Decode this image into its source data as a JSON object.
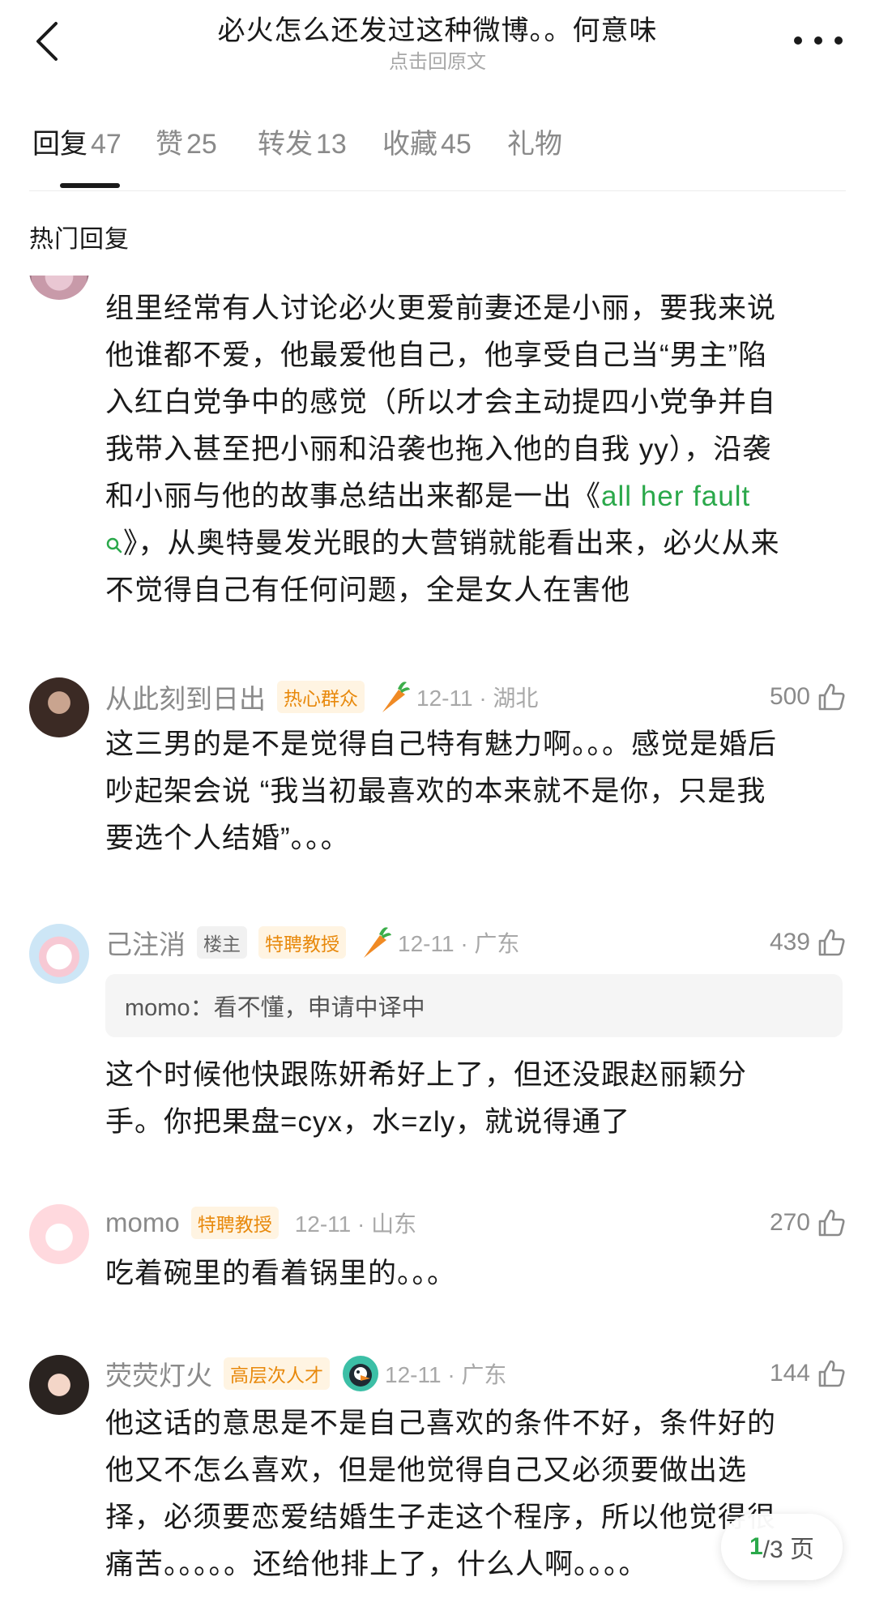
{
  "header": {
    "title": "必火怎么还发过这种微博。。何意味",
    "subtitle": "点击回原文"
  },
  "tabs": [
    {
      "label": "回复",
      "count": "47"
    },
    {
      "label": "赞",
      "count": "25"
    },
    {
      "label": "转发",
      "count": "13"
    },
    {
      "label": "收藏",
      "count": "45"
    },
    {
      "label": "礼物",
      "count": ""
    }
  ],
  "section_title": "热门回复",
  "comments": [
    {
      "body_lines": [
        "组里经常有人讨论必火更爱前妻还是小丽，要我来说",
        "他谁都不爱，他最爱他自己，他享受自己当“男主”陷",
        "入红白党争中的感觉（所以才会主动提四小党争并自",
        "我带入甚至把小丽和沿袭也拖入他的自我 yy），沿袭",
        "和小丽与他的故事总结出来都是一出《"
      ],
      "link": "all her fault",
      "body_after_link": [
        "》，从奥特曼发光眼的大营销就能看出来，必火从来",
        "不觉得自己有任何问题，全是女人在害他"
      ]
    },
    {
      "username": "从此刻到日出",
      "badge": "热心群众",
      "meta": "12-11 · 湖北",
      "likes": "500",
      "body_lines": [
        "这三男的是不是觉得自己特有魅力啊。。。感觉是婚后",
        "吵起架会说 “我当初最喜欢的本来就不是你，只是我",
        "要选个人结婚”。。。"
      ]
    },
    {
      "username": "己注消",
      "owner_badge": "楼主",
      "badge": "特聘教授",
      "meta": "12-11 · 广东",
      "likes": "439",
      "quote": "momo：看不懂，申请中译中",
      "body_lines": [
        "这个时候他快跟陈妍希好上了，但还没跟赵丽颖分",
        "手。你把果盘=cyx，水=zly，就说得通了"
      ]
    },
    {
      "username": "momo",
      "badge": "特聘教授",
      "meta": "12-11 · 山东",
      "likes": "270",
      "body_lines": [
        "吃着碗里的看着锅里的。。。"
      ]
    },
    {
      "username": "荧荧灯火",
      "badge": "高层次人才",
      "meta": "12-11 · 广东",
      "likes": "144",
      "body_lines": [
        "他这话的意思是不是自己喜欢的条件不好，条件好的",
        "他又不怎么喜欢，但是他觉得自己又必须要做出选",
        "择，必须要恋爱结婚生子走这个程序，所以他觉得很",
        "痛苦。。。。。还给他排上了，什么人啊。。。。"
      ]
    }
  ],
  "pager": {
    "current": "1",
    "total_text": "/3 页"
  },
  "colors": {
    "accent_green": "#2aa84a",
    "badge_orange": "#e8890c"
  }
}
